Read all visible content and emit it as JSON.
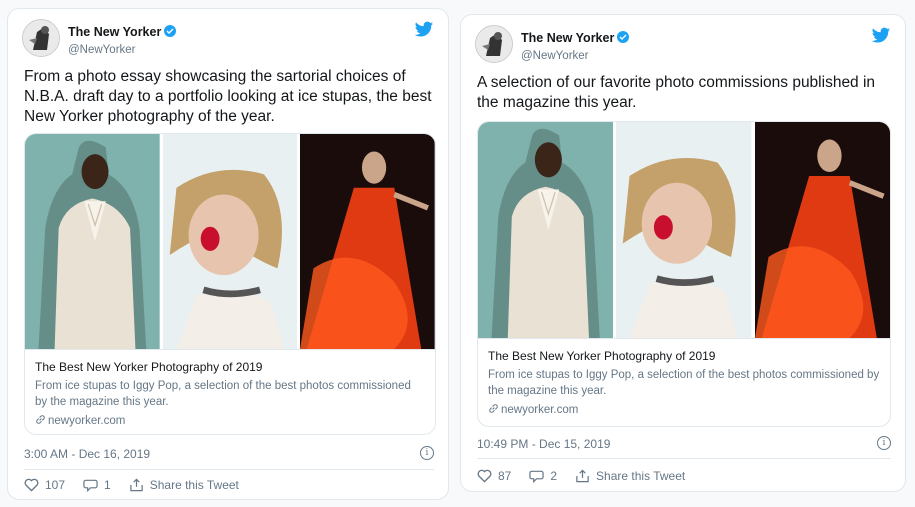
{
  "tweets": [
    {
      "display_name": "The New Yorker",
      "handle": "@NewYorker",
      "text": "From a photo essay showcasing the sartorial choices of N.B.A. draft day to a portfolio looking at ice stupas, the best New Yorker photography of the year.",
      "card": {
        "title": "The Best New Yorker Photography of 2019",
        "description": "From ice stupas to Iggy Pop, a selection of the best photos commissioned by the magazine this year.",
        "domain": "newyorker.com"
      },
      "timestamp": "3:00 AM - Dec 16, 2019",
      "likes": "107",
      "replies": "1",
      "share_label": "Share this Tweet"
    },
    {
      "display_name": "The New Yorker",
      "handle": "@NewYorker",
      "text": "A selection of our favorite photo commissions published in the magazine this year.",
      "card": {
        "title": "The Best New Yorker Photography of 2019",
        "description": "From ice stupas to Iggy Pop, a selection of the best photos commissioned by the magazine this year.",
        "domain": "newyorker.com"
      },
      "timestamp": "10:49 PM - Dec 15, 2019",
      "likes": "87",
      "replies": "2",
      "share_label": "Share this Tweet"
    }
  ],
  "icons": {
    "avatar": "new-yorker-logo",
    "verified": "verified-badge-icon",
    "twitter": "twitter-bird-icon",
    "like": "heart-icon",
    "reply": "reply-bubble-icon",
    "share": "share-icon",
    "info": "info-icon",
    "link": "link-icon"
  },
  "colors": {
    "brand_blue": "#1da1f2",
    "text_secondary": "#657786",
    "border": "#e1e8ed"
  }
}
